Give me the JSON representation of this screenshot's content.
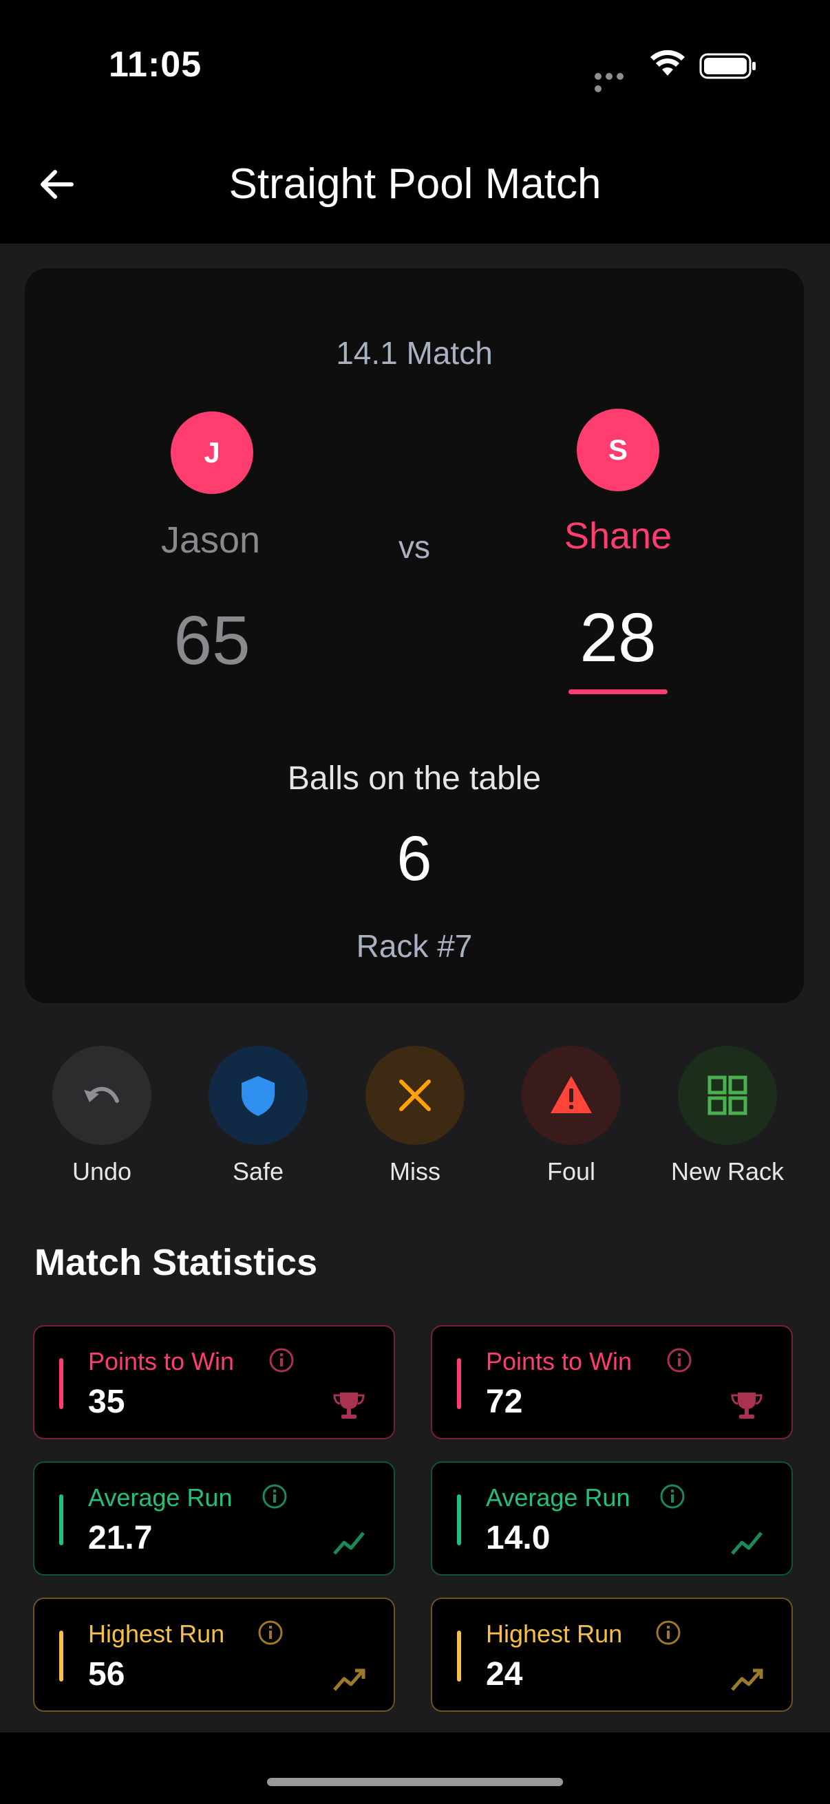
{
  "status_bar": {
    "time": "11:05"
  },
  "header": {
    "title": "Straight Pool Match"
  },
  "match": {
    "type": "14.1 Match",
    "vs": "vs",
    "player1": {
      "initial": "J",
      "name": "Jason",
      "score": "65"
    },
    "player2": {
      "initial": "S",
      "name": "Shane",
      "score": "28"
    },
    "active_player": "player2",
    "balls_label": "Balls on the table",
    "balls_count": "6",
    "rack": "Rack #7"
  },
  "actions": [
    {
      "label": "Undo",
      "icon": "undo-icon",
      "bg": "#2c2c2e",
      "color": "#8e8e93"
    },
    {
      "label": "Safe",
      "icon": "shield-icon",
      "bg": "#102a45",
      "color": "#2f8ff0"
    },
    {
      "label": "Miss",
      "icon": "close-icon",
      "bg": "#3d2a12",
      "color": "#ff9f0a"
    },
    {
      "label": "Foul",
      "icon": "warning-icon",
      "bg": "#3a1b1b",
      "color": "#ff453a"
    },
    {
      "label": "New Rack",
      "icon": "grid-icon",
      "bg": "#1c2d1c",
      "color": "#4caf50"
    }
  ],
  "stats": {
    "title": "Match Statistics",
    "player1": [
      {
        "label": "Points to Win",
        "value": "35",
        "icon": "trophy-icon",
        "color": "#ff3d6e"
      },
      {
        "label": "Average Run",
        "value": "21.7",
        "icon": "trend-icon",
        "color": "#22c07a"
      },
      {
        "label": "Highest Run",
        "value": "56",
        "icon": "trending-up-icon",
        "color": "#f5c04a"
      }
    ],
    "player2": [
      {
        "label": "Points to Win",
        "value": "72",
        "icon": "trophy-icon",
        "color": "#ff3d6e"
      },
      {
        "label": "Average Run",
        "value": "14.0",
        "icon": "trend-icon",
        "color": "#22c07a"
      },
      {
        "label": "Highest Run",
        "value": "24",
        "icon": "trending-up-icon",
        "color": "#f5c04a"
      }
    ]
  }
}
